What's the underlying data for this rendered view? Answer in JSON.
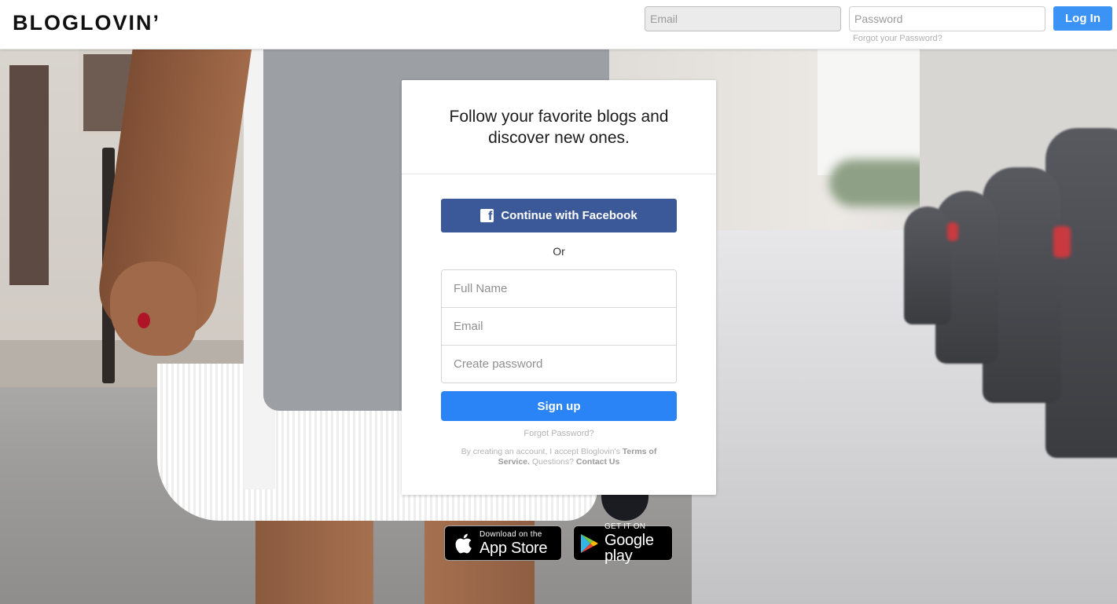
{
  "header": {
    "logo": "BLOGLOVIN’",
    "email_placeholder": "Email",
    "password_placeholder": "Password",
    "login_label": "Log In",
    "forgot_label": "Forgot your Password?"
  },
  "card": {
    "title": "Follow your favorite blogs and discover new ones.",
    "facebook_label": "Continue with Facebook",
    "or_label": "Or",
    "fields": {
      "full_name_placeholder": "Full Name",
      "email_placeholder": "Email",
      "password_placeholder": "Create password"
    },
    "signup_label": "Sign up",
    "forgot_label": "Forgot Password?",
    "terms": {
      "prefix": "By creating an account, I accept Bloglovin's",
      "terms_link": "Terms of Service.",
      "questions": "Questions?",
      "contact_link": "Contact Us"
    }
  },
  "badges": {
    "apple": {
      "small": "Download on the",
      "big": "App Store"
    },
    "google": {
      "small": "GET IT ON",
      "big": "Google play"
    }
  },
  "colors": {
    "login_button": "#3a93f5",
    "facebook_button": "#3b5998",
    "signup_button": "#2a84f5"
  }
}
